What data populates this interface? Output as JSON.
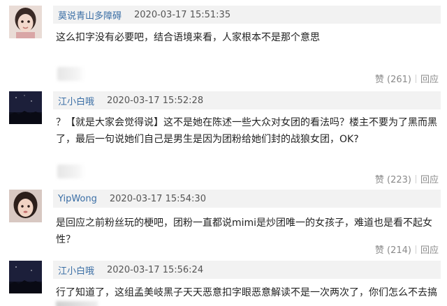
{
  "comments": [
    {
      "username": "莫说青山多障碍",
      "time": "2020-03-17 15:51:35",
      "text": "这么扣字没有必要吧，结合语境来看，人家根本不是那个意思",
      "likes": "赞 (261)",
      "reply": "回应",
      "avatar_icon": "girl-avatar"
    },
    {
      "username": "江小白哦",
      "time": "2020-03-17 15:52:28",
      "text": "？【就是大家会觉得说】这不是她在陈述一些大众对女团的看法吗？楼主不要为了黑而黑了，最后一句说她们自己是男生是因为团粉给她们封的战狼女团，OK?",
      "likes": "赞 (223)",
      "reply": "回应",
      "avatar_icon": "night-sky-avatar"
    },
    {
      "username": "YipWong",
      "time": "2020-03-17 15:54:30",
      "text": "是回应之前粉丝玩的梗吧，团粉一直都说mimi是炒团唯一的女孩子，难道也是看不起女性？",
      "likes": "赞 (214)",
      "reply": "回应",
      "avatar_icon": "woman-avatar"
    },
    {
      "username": "江小白哦",
      "time": "2020-03-17 15:56:24",
      "text": "行了知道了，这组孟美岐黑子天天恶意扣字眼恶意解读不是一次两次了，你们怎么不去搞",
      "avatar_icon": "night-sky-avatar"
    }
  ],
  "colors": {
    "username": "#3a6ea5",
    "meta_bar": "#f2f2f2",
    "text": "#222222",
    "muted": "#8a8a8a"
  }
}
